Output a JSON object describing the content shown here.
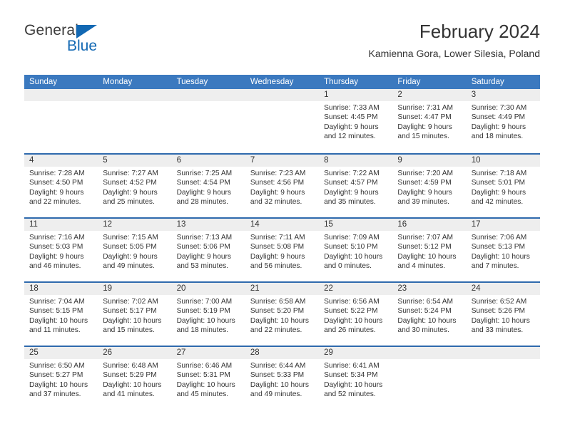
{
  "brand": {
    "name_part1": "General",
    "name_part2": "Blue",
    "triangle_color": "#1268b3"
  },
  "header": {
    "title": "February 2024",
    "subtitle": "Kamienna Gora, Lower Silesia, Poland"
  },
  "theme": {
    "header_blue": "#3b79bf",
    "separator_blue": "#2f6aad",
    "daynum_band": "#eeeeee",
    "text": "#333333"
  },
  "weekdays": [
    "Sunday",
    "Monday",
    "Tuesday",
    "Wednesday",
    "Thursday",
    "Friday",
    "Saturday"
  ],
  "weeks": [
    [
      {
        "day": "",
        "empty": true
      },
      {
        "day": "",
        "empty": true
      },
      {
        "day": "",
        "empty": true
      },
      {
        "day": "",
        "empty": true
      },
      {
        "day": "1",
        "sunrise": "Sunrise: 7:33 AM",
        "sunset": "Sunset: 4:45 PM",
        "daylight": "Daylight: 9 hours and 12 minutes."
      },
      {
        "day": "2",
        "sunrise": "Sunrise: 7:31 AM",
        "sunset": "Sunset: 4:47 PM",
        "daylight": "Daylight: 9 hours and 15 minutes."
      },
      {
        "day": "3",
        "sunrise": "Sunrise: 7:30 AM",
        "sunset": "Sunset: 4:49 PM",
        "daylight": "Daylight: 9 hours and 18 minutes."
      }
    ],
    [
      {
        "day": "4",
        "sunrise": "Sunrise: 7:28 AM",
        "sunset": "Sunset: 4:50 PM",
        "daylight": "Daylight: 9 hours and 22 minutes."
      },
      {
        "day": "5",
        "sunrise": "Sunrise: 7:27 AM",
        "sunset": "Sunset: 4:52 PM",
        "daylight": "Daylight: 9 hours and 25 minutes."
      },
      {
        "day": "6",
        "sunrise": "Sunrise: 7:25 AM",
        "sunset": "Sunset: 4:54 PM",
        "daylight": "Daylight: 9 hours and 28 minutes."
      },
      {
        "day": "7",
        "sunrise": "Sunrise: 7:23 AM",
        "sunset": "Sunset: 4:56 PM",
        "daylight": "Daylight: 9 hours and 32 minutes."
      },
      {
        "day": "8",
        "sunrise": "Sunrise: 7:22 AM",
        "sunset": "Sunset: 4:57 PM",
        "daylight": "Daylight: 9 hours and 35 minutes."
      },
      {
        "day": "9",
        "sunrise": "Sunrise: 7:20 AM",
        "sunset": "Sunset: 4:59 PM",
        "daylight": "Daylight: 9 hours and 39 minutes."
      },
      {
        "day": "10",
        "sunrise": "Sunrise: 7:18 AM",
        "sunset": "Sunset: 5:01 PM",
        "daylight": "Daylight: 9 hours and 42 minutes."
      }
    ],
    [
      {
        "day": "11",
        "sunrise": "Sunrise: 7:16 AM",
        "sunset": "Sunset: 5:03 PM",
        "daylight": "Daylight: 9 hours and 46 minutes."
      },
      {
        "day": "12",
        "sunrise": "Sunrise: 7:15 AM",
        "sunset": "Sunset: 5:05 PM",
        "daylight": "Daylight: 9 hours and 49 minutes."
      },
      {
        "day": "13",
        "sunrise": "Sunrise: 7:13 AM",
        "sunset": "Sunset: 5:06 PM",
        "daylight": "Daylight: 9 hours and 53 minutes."
      },
      {
        "day": "14",
        "sunrise": "Sunrise: 7:11 AM",
        "sunset": "Sunset: 5:08 PM",
        "daylight": "Daylight: 9 hours and 56 minutes."
      },
      {
        "day": "15",
        "sunrise": "Sunrise: 7:09 AM",
        "sunset": "Sunset: 5:10 PM",
        "daylight": "Daylight: 10 hours and 0 minutes."
      },
      {
        "day": "16",
        "sunrise": "Sunrise: 7:07 AM",
        "sunset": "Sunset: 5:12 PM",
        "daylight": "Daylight: 10 hours and 4 minutes."
      },
      {
        "day": "17",
        "sunrise": "Sunrise: 7:06 AM",
        "sunset": "Sunset: 5:13 PM",
        "daylight": "Daylight: 10 hours and 7 minutes."
      }
    ],
    [
      {
        "day": "18",
        "sunrise": "Sunrise: 7:04 AM",
        "sunset": "Sunset: 5:15 PM",
        "daylight": "Daylight: 10 hours and 11 minutes."
      },
      {
        "day": "19",
        "sunrise": "Sunrise: 7:02 AM",
        "sunset": "Sunset: 5:17 PM",
        "daylight": "Daylight: 10 hours and 15 minutes."
      },
      {
        "day": "20",
        "sunrise": "Sunrise: 7:00 AM",
        "sunset": "Sunset: 5:19 PM",
        "daylight": "Daylight: 10 hours and 18 minutes."
      },
      {
        "day": "21",
        "sunrise": "Sunrise: 6:58 AM",
        "sunset": "Sunset: 5:20 PM",
        "daylight": "Daylight: 10 hours and 22 minutes."
      },
      {
        "day": "22",
        "sunrise": "Sunrise: 6:56 AM",
        "sunset": "Sunset: 5:22 PM",
        "daylight": "Daylight: 10 hours and 26 minutes."
      },
      {
        "day": "23",
        "sunrise": "Sunrise: 6:54 AM",
        "sunset": "Sunset: 5:24 PM",
        "daylight": "Daylight: 10 hours and 30 minutes."
      },
      {
        "day": "24",
        "sunrise": "Sunrise: 6:52 AM",
        "sunset": "Sunset: 5:26 PM",
        "daylight": "Daylight: 10 hours and 33 minutes."
      }
    ],
    [
      {
        "day": "25",
        "sunrise": "Sunrise: 6:50 AM",
        "sunset": "Sunset: 5:27 PM",
        "daylight": "Daylight: 10 hours and 37 minutes."
      },
      {
        "day": "26",
        "sunrise": "Sunrise: 6:48 AM",
        "sunset": "Sunset: 5:29 PM",
        "daylight": "Daylight: 10 hours and 41 minutes."
      },
      {
        "day": "27",
        "sunrise": "Sunrise: 6:46 AM",
        "sunset": "Sunset: 5:31 PM",
        "daylight": "Daylight: 10 hours and 45 minutes."
      },
      {
        "day": "28",
        "sunrise": "Sunrise: 6:44 AM",
        "sunset": "Sunset: 5:33 PM",
        "daylight": "Daylight: 10 hours and 49 minutes."
      },
      {
        "day": "29",
        "sunrise": "Sunrise: 6:41 AM",
        "sunset": "Sunset: 5:34 PM",
        "daylight": "Daylight: 10 hours and 52 minutes."
      },
      {
        "day": "",
        "empty": true
      },
      {
        "day": "",
        "empty": true
      }
    ]
  ]
}
